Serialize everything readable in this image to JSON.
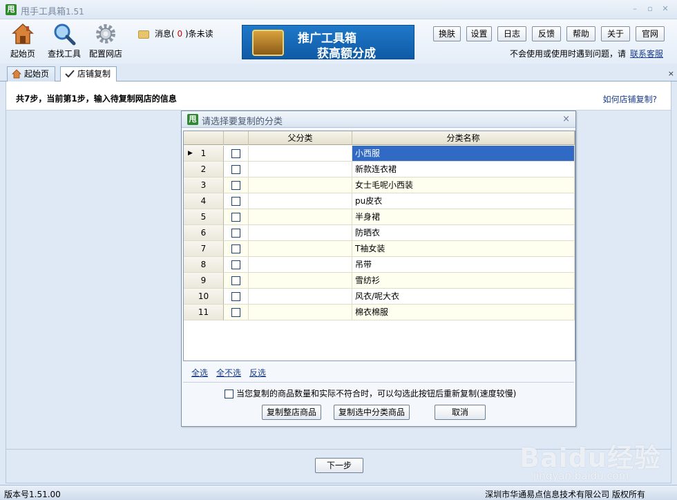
{
  "window": {
    "logo_char": "甩",
    "title": "甩手工具箱",
    "version": "1.51",
    "min_glyph": "–",
    "max_glyph": "▫",
    "close_glyph": "✕"
  },
  "toolbar": {
    "home_label": "起始页",
    "search_label": "查找工具",
    "config_label": "配置网店",
    "msg_prefix": "消息(",
    "msg_count": "0",
    "msg_suffix": ")条未读",
    "banner_line1": "推广工具箱",
    "banner_line2": "获高额分成",
    "buttons": [
      "换肤",
      "设置",
      "日志",
      "反馈",
      "帮助",
      "关于",
      "官网"
    ],
    "help_text": "不会使用或使用时遇到问题，请",
    "help_link": "联系客服"
  },
  "tabs": [
    {
      "label": "起始页",
      "icon": "home-icon"
    },
    {
      "label": "店铺复制",
      "icon": "check-pen-icon"
    }
  ],
  "tab_close_glyph": "×",
  "main": {
    "step_text": "共7步，当前第1步，输入待复制网店的信息",
    "howto_link": "如何店铺复制?",
    "next_button": "下一步"
  },
  "dialog": {
    "title": "请选择要复制的分类",
    "close_glyph": "×",
    "columns": [
      "父分类",
      "分类名称"
    ],
    "rows": [
      {
        "num": "1",
        "parent": "",
        "name": "小西服",
        "selected": true
      },
      {
        "num": "2",
        "parent": "",
        "name": "新款连衣裙"
      },
      {
        "num": "3",
        "parent": "",
        "name": "女士毛呢小西装"
      },
      {
        "num": "4",
        "parent": "",
        "name": "pu皮衣"
      },
      {
        "num": "5",
        "parent": "",
        "name": "半身裙"
      },
      {
        "num": "6",
        "parent": "",
        "name": "防晒衣"
      },
      {
        "num": "7",
        "parent": "",
        "name": "T袖女装"
      },
      {
        "num": "8",
        "parent": "",
        "name": "吊带"
      },
      {
        "num": "9",
        "parent": "",
        "name": "雪纺衫"
      },
      {
        "num": "10",
        "parent": "",
        "name": "风衣/呢大衣"
      },
      {
        "num": "11",
        "parent": "",
        "name": "棉衣棉服"
      }
    ],
    "select_all": "全选",
    "select_none": "全不选",
    "select_invert": "反选",
    "recopy_option": "当您复制的商品数量和实际不符合时，可以勾选此按钮后重新复制(速度较慢)",
    "btn_copy_store": "复制整店商品",
    "btn_copy_selected": "复制选中分类商品",
    "btn_cancel": "取消"
  },
  "status": {
    "version_text": "版本号1.51.00",
    "company_text": "深圳市华通易点信息技术有限公司  版权所有"
  },
  "watermark": {
    "brand": "Baidu经验",
    "sub": "jingyan.baidu.com"
  }
}
